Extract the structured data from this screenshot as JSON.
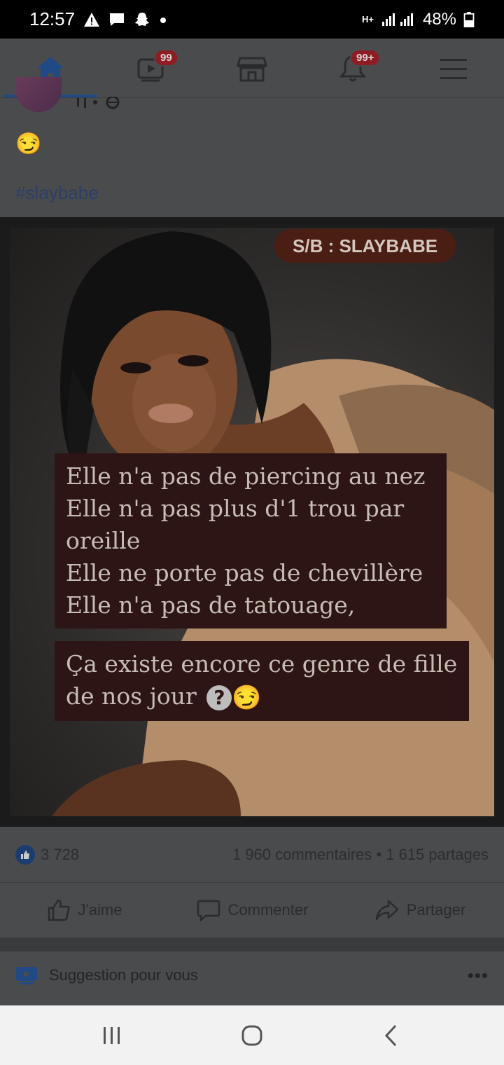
{
  "status_bar": {
    "time": "12:57",
    "network": "H+",
    "battery": "48%",
    "icons": [
      "warning-icon",
      "chat-icon",
      "snapchat-icon",
      "dot-icon",
      "signal-icon",
      "battery-icon"
    ]
  },
  "nav": {
    "tabs": [
      {
        "name": "home",
        "icon": "home-icon",
        "badge": ""
      },
      {
        "name": "watch",
        "icon": "video-icon",
        "badge": "99"
      },
      {
        "name": "marketplace",
        "icon": "store-icon",
        "badge": ""
      },
      {
        "name": "notifications",
        "icon": "bell-icon",
        "badge": "99+"
      },
      {
        "name": "menu",
        "icon": "hamburger-icon",
        "badge": ""
      }
    ],
    "active_color": "#1f4a86"
  },
  "post": {
    "emoji": "😏",
    "hashtag": "#slaybabe",
    "image": {
      "label": "S/B : SLAYBABE",
      "caption_1": [
        "Elle n'a pas de piercing au nez",
        "Elle n'a pas plus d'1 trou par",
        "oreille",
        "Elle ne porte pas de chevillère",
        "Elle n'a pas de tatouage,"
      ],
      "caption_2_line1": "Ça existe encore ce genre de fille",
      "caption_2_line2": "de nos jour",
      "question_mark": "?",
      "smirk": "😏"
    },
    "likes": "3 728",
    "comments_shares": "1 960 commentaires • 1 615 partages",
    "actions": {
      "like": "J'aime",
      "comment": "Commenter",
      "share": "Partager"
    }
  },
  "suggestion": {
    "label": "Suggestion pour vous",
    "more": "•••"
  }
}
